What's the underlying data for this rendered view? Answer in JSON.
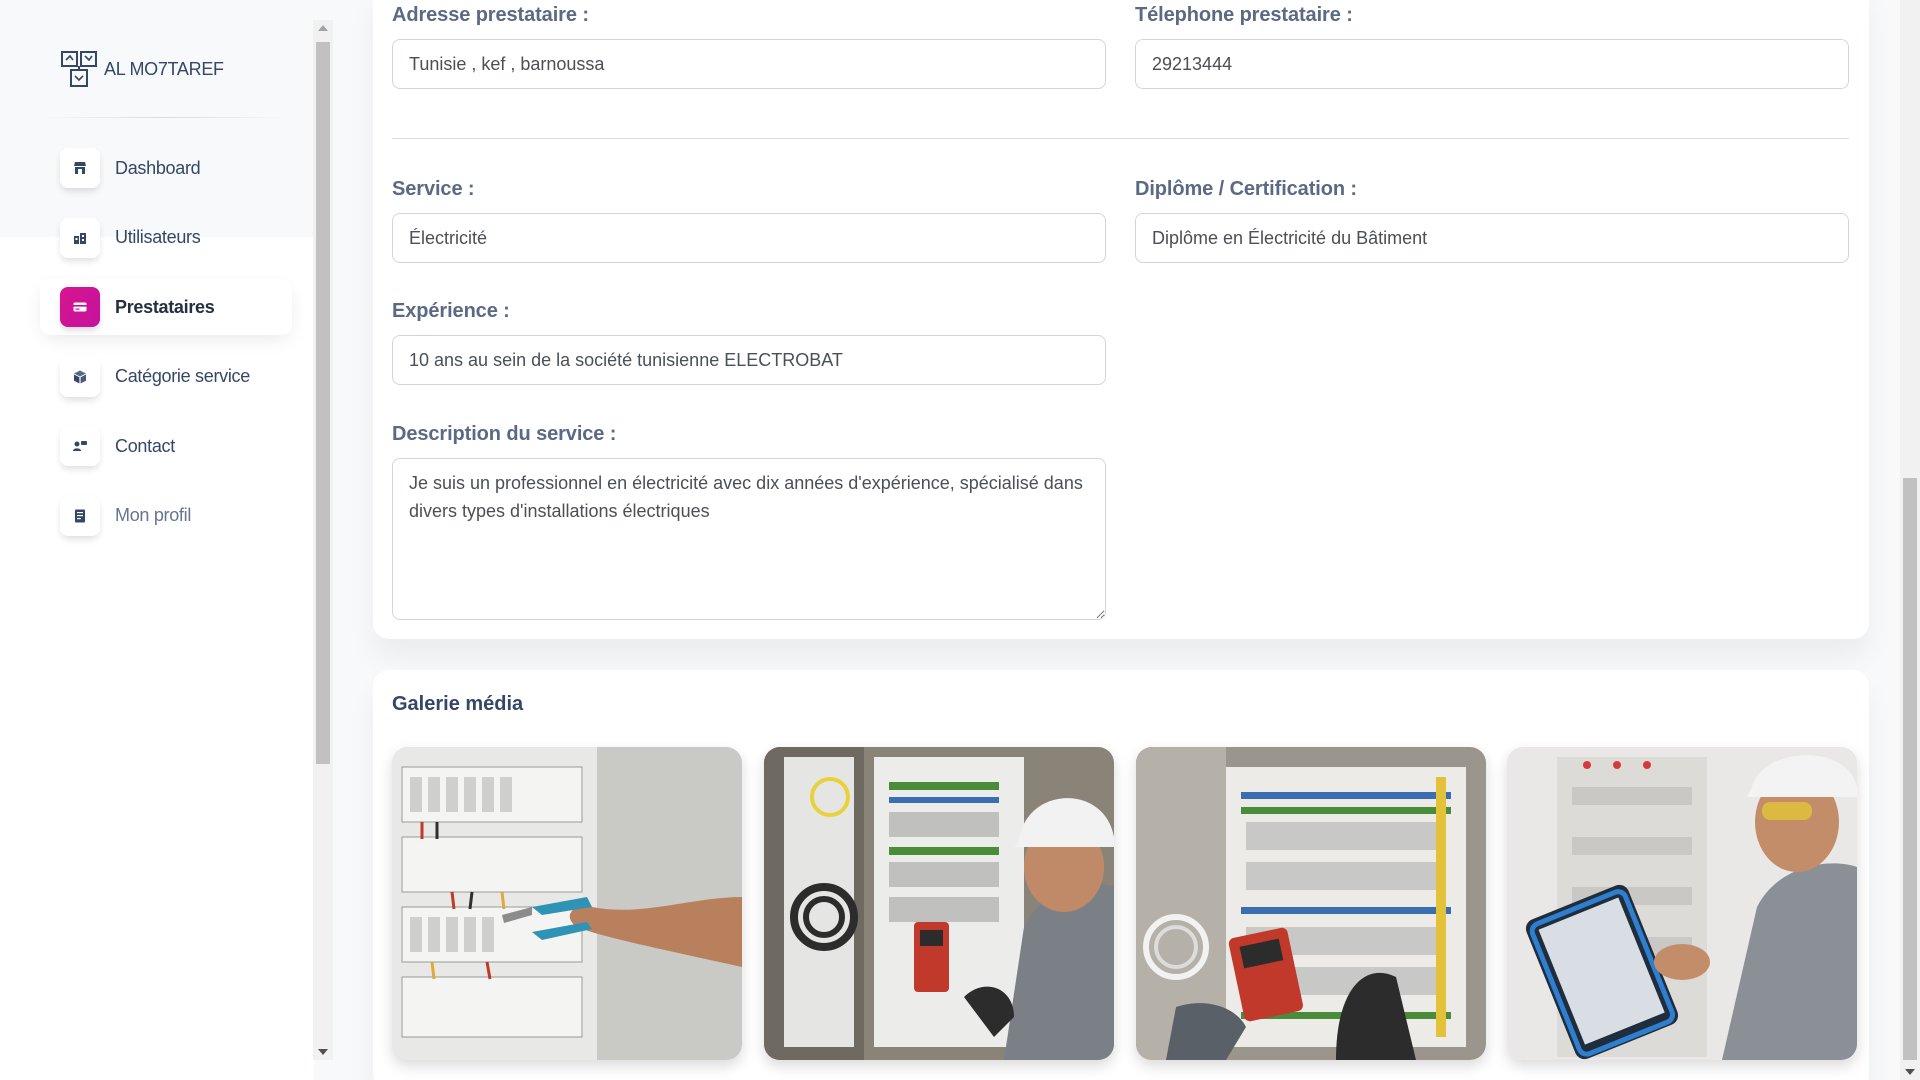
{
  "brand": {
    "name": "AL MO7TAREF",
    "logo_icon": "brand-logo-icon"
  },
  "sidebar": {
    "items": [
      {
        "label": "Dashboard",
        "icon": "shop-icon",
        "active": false
      },
      {
        "label": "Utilisateurs",
        "icon": "office-icon",
        "active": false
      },
      {
        "label": "Prestataires",
        "icon": "credit-card-icon",
        "active": true
      },
      {
        "label": "Catégorie service",
        "icon": "box-icon",
        "active": false
      },
      {
        "label": "Contact",
        "icon": "user-chat-icon",
        "active": false
      },
      {
        "label": "Mon profil",
        "icon": "document-icon",
        "active": false
      }
    ],
    "accent_color": "#cb0c9f"
  },
  "form": {
    "adresse": {
      "label": "Adresse prestataire :",
      "value": "Tunisie , kef , barnoussa"
    },
    "telephone": {
      "label": "Télephone prestataire :",
      "value": "29213444"
    },
    "service": {
      "label": "Service :",
      "value": "Électricité"
    },
    "diplome": {
      "label": "Diplôme / Certification :",
      "value": "Diplôme en Électricité du Bâtiment"
    },
    "experience": {
      "label": "Expérience :",
      "value": "10 ans au sein de la société tunisienne ELECTROBAT"
    },
    "description": {
      "label": "Description du service :",
      "value": "Je suis un professionnel en électricité avec dix années d'expérience, spécialisé dans divers types d'installations électriques"
    }
  },
  "gallery": {
    "title": "Galerie média",
    "images": [
      {
        "name": "gallery-image-electrical-panel-pliers"
      },
      {
        "name": "gallery-image-electrician-helmet-multimeter"
      },
      {
        "name": "gallery-image-panel-multimeter-gloves"
      },
      {
        "name": "gallery-image-electrician-tablet"
      }
    ]
  }
}
